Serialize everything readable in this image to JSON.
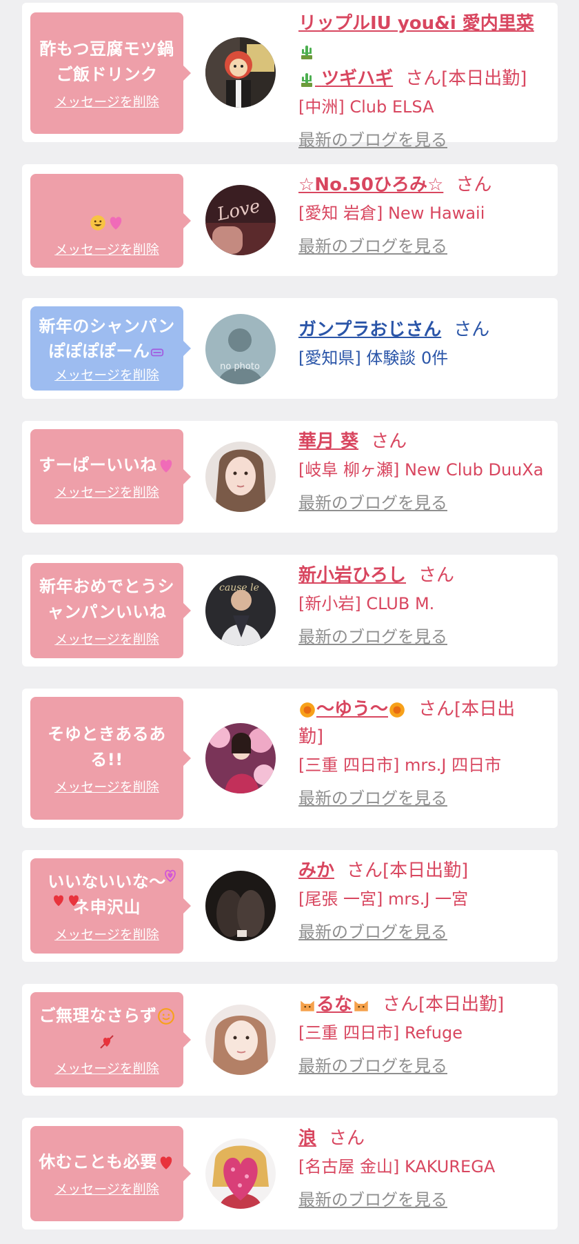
{
  "delete_label": "メッセージを削除",
  "blog_label": "最新のブログを見る",
  "colors": {
    "pink_bubble": "#ee9fa9",
    "blue_bubble": "#9dbcf0",
    "accent": "#d8465f",
    "link_blue": "#2a55a8"
  },
  "messages": [
    {
      "bubble_text": "酢もつ豆腐モツ鍋\nご飯ドリンク",
      "name": "リップルIU you&i 愛内里菜",
      "name_line2": "ツギハギ",
      "suffix": "さん[本日出勤]",
      "shop": "[中洲] Club ELSA",
      "icons": [
        "cactus-emoji",
        "cactus-emoji"
      ]
    },
    {
      "bubble_text": "",
      "name": "☆No.50ひろみ☆",
      "suffix": "さん",
      "shop": "[愛知 岩倉] New Hawaii",
      "icons": [
        "grinning-face-emoji",
        "two-hearts-emoji"
      ]
    },
    {
      "bubble_text": "新年のシャンパン\nぽぽぽぽーん",
      "name": "ガンプラおじさん",
      "suffix": "さん",
      "shop": "[愛知県] 体験談 0件",
      "avatar_text": "no photo",
      "icons": [
        "face-emoji"
      ]
    },
    {
      "bubble_text": "すーぱーいいね",
      "name": "華月 葵",
      "suffix": "さん",
      "shop": "[岐阜 柳ヶ瀬] New Club DuuXa",
      "icons": [
        "sparkling-heart-emoji"
      ]
    },
    {
      "bubble_text": "新年おめでとうシ\nャンパンいいね",
      "name": "新小岩ひろし",
      "suffix": "さん",
      "shop": "[新小岩] CLUB M."
    },
    {
      "bubble_text": "そゆときあるあ\nる!!",
      "name": "〜ゆう〜",
      "suffix": "さん[本日出\n勤]",
      "shop": "[三重 四日市] mrs.J 四日市",
      "icons": [
        "sunflower-emoji",
        "sunflower-emoji"
      ]
    },
    {
      "bubble_text": "いいないいな〜\nネ申沢山",
      "name": "みか",
      "suffix": "さん[本日出勤]",
      "shop": "[尾張 一宮] mrs.J 一宮",
      "icons": [
        "heart-eyes-emoji",
        "two-hearts-emoji",
        "red-heart-emoji"
      ]
    },
    {
      "bubble_text": "ご無理なさらず",
      "name": "るな",
      "suffix": "さん[本日出勤]",
      "shop": "[三重 四日市] Refuge",
      "icons": [
        "smiling-face-emoji",
        "heart-with-arrow-emoji",
        "cat-emoji",
        "cat-emoji"
      ]
    },
    {
      "bubble_text": "休むことも必要",
      "name": "浪",
      "suffix": "さん",
      "shop": "[名古屋 金山] KAKUREGA",
      "icons": [
        "red-heart-emoji"
      ]
    }
  ]
}
